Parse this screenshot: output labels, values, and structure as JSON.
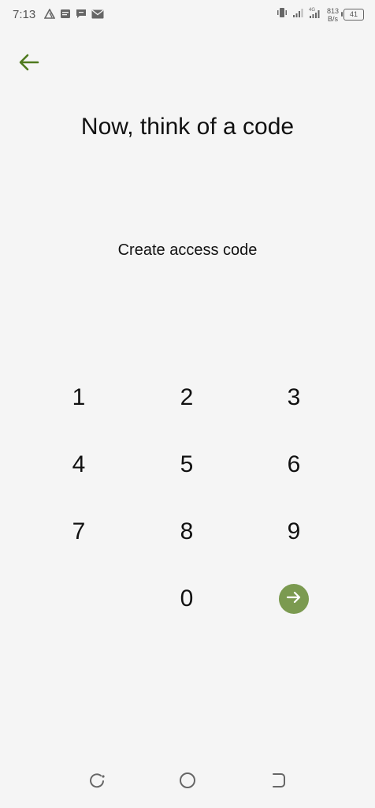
{
  "status_bar": {
    "time": "7:13",
    "left_icons": [
      "triangle-icon",
      "notes-icon",
      "message-icon",
      "mail-icon"
    ],
    "right_icons": [
      "vibrate-icon",
      "signal-icon",
      "4g-signal-icon"
    ],
    "network_speed_value": "813",
    "network_speed_unit": "B/s",
    "battery_level": "41"
  },
  "colors": {
    "accent": "#7b9a50",
    "back_arrow": "#4f7a1e",
    "background": "#f5f5f5"
  },
  "header": {
    "title": "Now, think of a code"
  },
  "main": {
    "subtitle": "Create access code"
  },
  "keypad": {
    "keys": [
      "1",
      "2",
      "3",
      "4",
      "5",
      "6",
      "7",
      "8",
      "9",
      "0"
    ],
    "submit_icon": "arrow-right-icon"
  },
  "nav_bar": {
    "icons": [
      "recent-apps-icon",
      "home-icon",
      "back-nav-icon"
    ]
  }
}
